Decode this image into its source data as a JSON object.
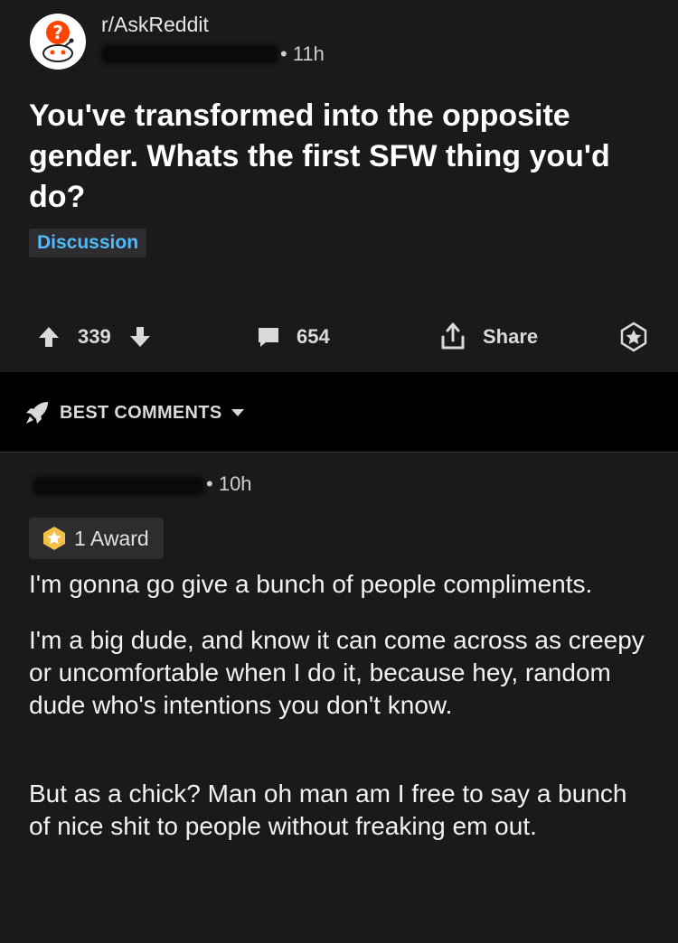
{
  "post": {
    "subreddit": "r/AskReddit",
    "time_ago": "11h",
    "title": "You've transformed into the opposite gender. Whats the first SFW thing you'd do?",
    "flair": "Discussion",
    "flair_color": "#4fbcff",
    "upvotes": "339",
    "comments": "654",
    "share_label": "Share"
  },
  "sort": {
    "label": "BEST COMMENTS"
  },
  "comment": {
    "time_ago": "10h",
    "award_label": "1 Award",
    "paragraphs": [
      "I'm gonna go give a bunch of people compliments.",
      "I'm a big dude, and know it can come across as creepy or uncomfortable when I do it, because hey, random dude who's intentions you don't know.",
      "But as a chick? Man oh man am I free to say a bunch of nice shit to people without freaking em out."
    ]
  },
  "icons": {
    "subreddit": "askreddit-snoo-icon",
    "upvote": "arrow-up-icon",
    "downvote": "arrow-down-icon",
    "comment": "comment-bubble-icon",
    "share": "share-icon",
    "award": "award-star-icon",
    "sort": "rocket-icon",
    "dropdown": "caret-down-icon"
  }
}
